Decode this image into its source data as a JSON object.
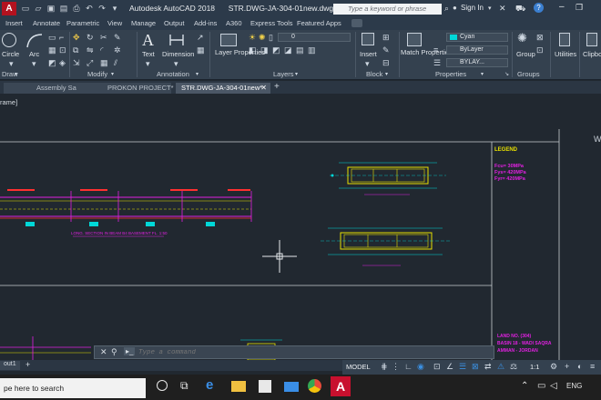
{
  "title_bar": {
    "app_title": "Autodesk AutoCAD 2018",
    "file_name": "STR.DWG-JA-304-01new.dwg",
    "search_placeholder": "Type a keyword or phrase",
    "sign_in": "Sign In"
  },
  "ribbon_tabs": [
    "Insert",
    "Annotate",
    "Parametric",
    "View",
    "Manage",
    "Output",
    "Add-ins",
    "A360",
    "Express Tools",
    "Featured Apps"
  ],
  "ribbon": {
    "draw": {
      "circle": "Circle",
      "arc": "Arc",
      "panel_label": "Draw"
    },
    "modify": {
      "panel_label": "Modify"
    },
    "annotation": {
      "text": "Text",
      "dimension": "Dimension",
      "panel_label": "Annotation"
    },
    "layers": {
      "layer_properties": "Layer Properties",
      "layer_value": "0",
      "panel_label": "Layers"
    },
    "block": {
      "insert": "Insert",
      "panel_label": "Block"
    },
    "properties": {
      "match_properties": "Match Properties",
      "color": "Cyan",
      "linetype": "ByLayer",
      "lineweight": "BYLAY...",
      "panel_label": "Properties"
    },
    "groups": {
      "group": "Group",
      "panel_label": "Groups"
    },
    "utilities": {
      "label": "Utilities"
    },
    "clipboard": {
      "label": "Clipbo"
    }
  },
  "doc_tabs": [
    {
      "label": "Assembly Sample*",
      "active": false
    },
    {
      "label": "PROKON PROJECT*",
      "active": false
    },
    {
      "label": "STR.DWG-JA-304-01new*",
      "active": true
    }
  ],
  "viewport_label": "rame]",
  "drawing": {
    "legend_title": "LEGEND",
    "legend_lines": [
      "Fcu= 30MPa",
      "Fys= 420MPa",
      "Fyr= 420MPa"
    ],
    "section_label": "LONG. SECTION IN BEAM B4 BASEMENT FL. 1:50",
    "title_block": [
      "LAND NO. (304)",
      "BASIN 18 - WADI SAQRA",
      "AMMAN - JORDAN"
    ]
  },
  "command_line": {
    "placeholder": "Type a command"
  },
  "layout_tab": "out1",
  "status": {
    "model": "MODEL",
    "scale": "1:1"
  },
  "taskbar": {
    "search": "pe here to search",
    "language": "ENG"
  },
  "colors": {
    "canvas": "#212830",
    "ribbon": "#34414f",
    "cyan": "#00d8d8",
    "magenta": "#e020e0",
    "yellow": "#e8e000",
    "red_logo": "#c8102e"
  }
}
